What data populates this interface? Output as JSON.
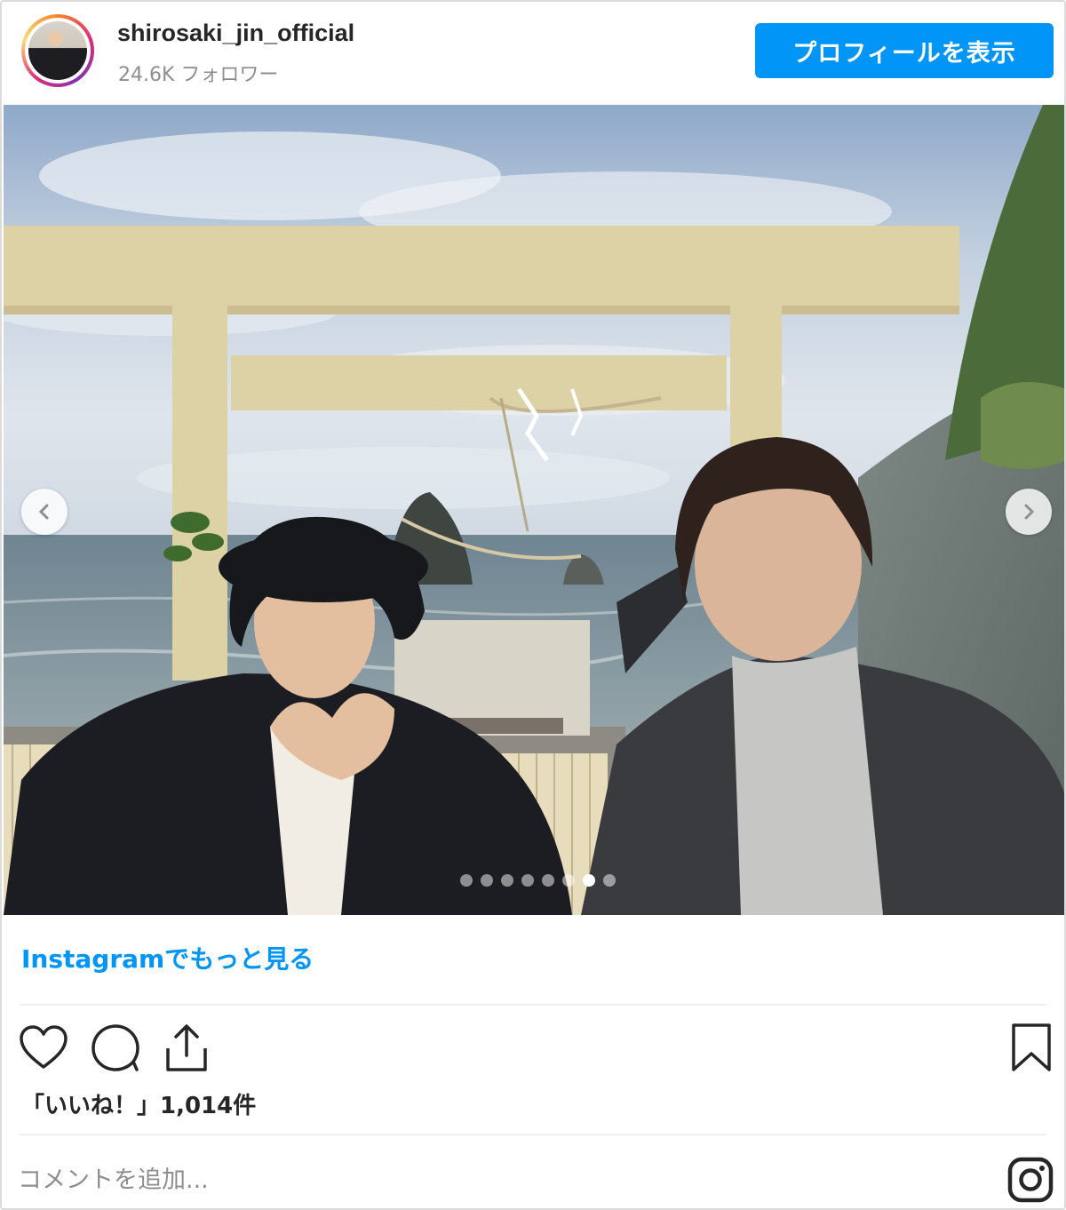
{
  "header": {
    "username": "shirosaki_jin_official",
    "followers": "24.6K フォロワー",
    "view_profile_label": "プロフィールを表示"
  },
  "post": {
    "photo_alt": "",
    "carousel": {
      "count": 8,
      "active_index": 6
    },
    "prev_icon": "chevron-left-icon",
    "next_icon": "chevron-right-icon"
  },
  "more_link": "Instagramでもっと見る",
  "actions": {
    "like_icon": "heart-icon",
    "comment_icon": "comment-icon",
    "share_icon": "share-icon",
    "save_icon": "bookmark-icon"
  },
  "likes_text": "「いいね！」1,014件",
  "comment": {
    "placeholder": "コメントを追加..."
  },
  "colors": {
    "accent": "#0095f6",
    "text": "#262626",
    "muted": "#8e8e8e"
  }
}
